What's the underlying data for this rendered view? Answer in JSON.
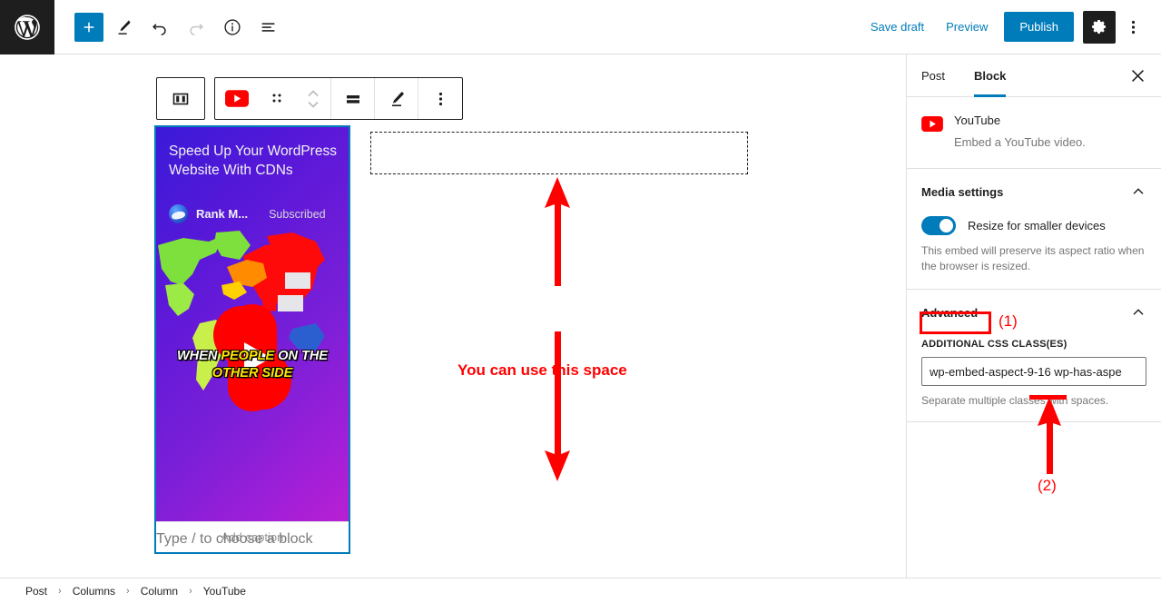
{
  "topbar": {
    "logo_icon": "wordpress-logo-icon",
    "add_block_icon": "plus-icon",
    "tools_icon": "pencil-edit-icon",
    "undo_icon": "undo-arrow-icon",
    "redo_icon": "redo-arrow-icon",
    "details_icon": "info-circle-icon",
    "list_view_icon": "list-view-icon",
    "save_draft_label": "Save draft",
    "preview_label": "Preview",
    "publish_label": "Publish",
    "settings_icon": "gear-icon",
    "options_icon": "kebab-vertical-icon",
    "accent_color": "#007cba",
    "dark_color": "#1e1e1e"
  },
  "block_toolbar": {
    "parent_block_icon": "columns-block-icon",
    "block_type_icon": "youtube-icon",
    "drag_icon": "drag-handle-dots-icon",
    "move_icon": "move-up-down-chevrons-icon",
    "align_icon": "align-wide-icon",
    "edit_icon": "pencil-edit-icon",
    "more_icon": "kebab-vertical-icon"
  },
  "video_block": {
    "title": "Speed Up Your WordPress Website With CDNs",
    "channel_name": "Rank M...",
    "subscribe_label": "Subscribed",
    "overlay_line1_a": "WHEN ",
    "overlay_line1_b": "PEOPLE",
    "overlay_line1_c": " ON THE",
    "overlay_line2": "OTHER SIDE",
    "caption_placeholder": "Add caption",
    "play_icon": "youtube-shorts-play-icon",
    "avatar_icon": "channel-avatar",
    "selection_color": "#007cba"
  },
  "canvas": {
    "empty_block_name": "empty-column-placeholder",
    "paragraph_placeholder": "Type / to choose a block"
  },
  "annotations": {
    "space_note": "You can use this space",
    "marker_one": "(1)",
    "marker_two": "(2)",
    "color": "#ff0000"
  },
  "sidebar": {
    "tabs": [
      {
        "label": "Post",
        "active": false
      },
      {
        "label": "Block",
        "active": true
      }
    ],
    "close_icon": "close-x-icon",
    "block_card": {
      "icon": "youtube-icon",
      "title": "YouTube",
      "description": "Embed a YouTube video."
    },
    "media_settings": {
      "title": "Media settings",
      "collapse_icon": "chevron-up-icon",
      "toggle_label": "Resize for smaller devices",
      "toggle_on": true,
      "help": "This embed will preserve its aspect ratio when the browser is resized."
    },
    "advanced": {
      "title": "Advanced",
      "collapse_icon": "chevron-up-icon",
      "css_field_label": "ADDITIONAL CSS CLASS(ES)",
      "css_field_value": "wp-embed-aspect-9-16 wp-has-aspe",
      "css_field_placeholder": "",
      "css_field_help": "Separate multiple classes with spaces."
    }
  },
  "breadcrumb": {
    "items": [
      "Post",
      "Columns",
      "Column",
      "YouTube"
    ],
    "separator": "›"
  }
}
